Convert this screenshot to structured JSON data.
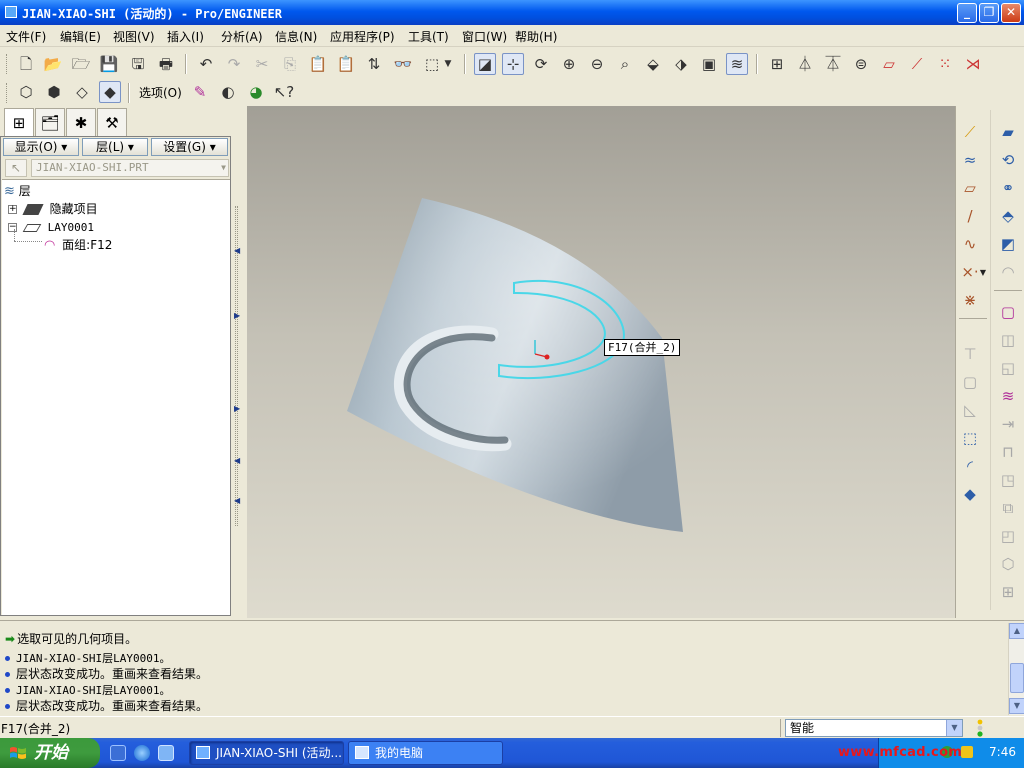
{
  "window": {
    "title": "JIAN-XIAO-SHI (活动的) - Pro/ENGINEER",
    "controls": {
      "minimize": "_",
      "restore": "❐",
      "close": "✕"
    }
  },
  "menubar": [
    "文件(F)",
    "编辑(E)",
    "视图(V)",
    "插入(I)",
    "分析(A)",
    "信息(N)",
    "应用程序(P)",
    "工具(T)",
    "窗口(W)",
    "帮助(H)"
  ],
  "toolbar2": {
    "options_label": "选项(O)"
  },
  "left_panel": {
    "buttons": {
      "show": "显示(O) ▾",
      "layer": "层(L) ▾",
      "settings": "设置(G) ▾"
    },
    "filter_value": "JIAN-XIAO-SHI.PRT",
    "tree": {
      "root": "层",
      "items": [
        {
          "label": "隐藏项目",
          "expander": "+"
        },
        {
          "label": "LAY0001",
          "expander": "−"
        },
        {
          "label": "面组:F12"
        }
      ]
    }
  },
  "viewport": {
    "tag_label": "F17(合并_2)"
  },
  "messages": [
    {
      "text": "选取可见的几何项目。",
      "icon": "arrow-icon"
    },
    {
      "text": "JIAN-XIAO-SHI层LAY0001。",
      "icon": "bullet-icon"
    },
    {
      "text": "层状态改变成功。重画来查看结果。",
      "icon": "bullet-icon"
    },
    {
      "text": "JIAN-XIAO-SHI层LAY0001。",
      "icon": "bullet-icon"
    },
    {
      "text": "层状态改变成功。重画来查看结果。",
      "icon": "bullet-icon"
    }
  ],
  "statusbar": {
    "text": "F17(合并_2)",
    "filter_value": "智能"
  },
  "taskbar": {
    "start_label": "开始",
    "tasks": [
      {
        "label": "JIAN-XIAO-SHI (活动...",
        "active": true
      },
      {
        "label": "我的电脑",
        "active": false
      }
    ],
    "clock": "7:46"
  },
  "watermark": "www.mfcad.com",
  "colors": {
    "selection_highlight": "#4ad7e8",
    "title_bar": "#0058ee",
    "taskbar": "#245edc",
    "start": "#3e9b3e"
  }
}
